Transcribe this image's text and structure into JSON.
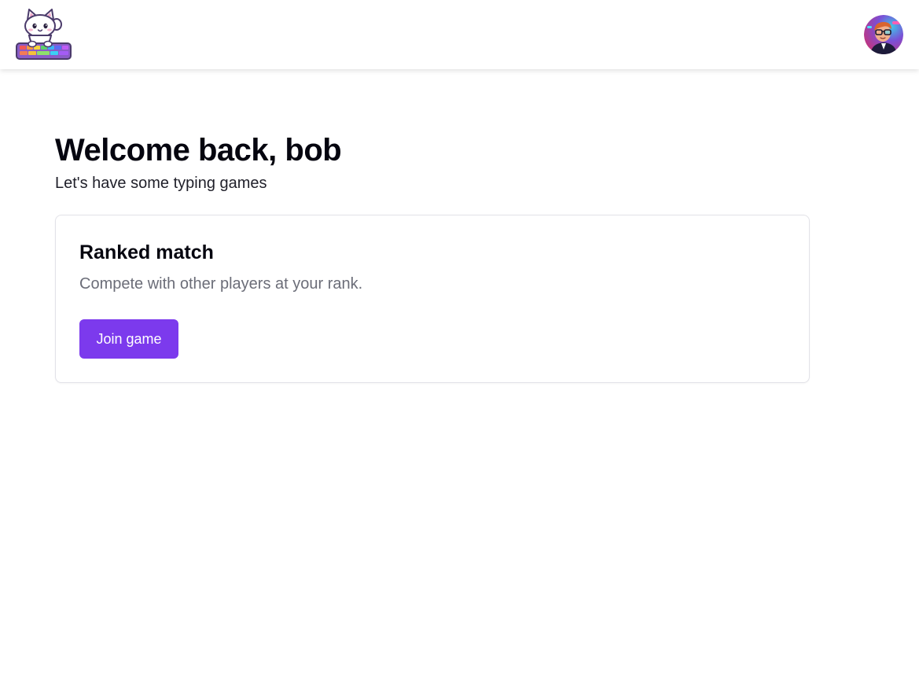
{
  "header": {
    "logo_icon": "cat-keyboard-logo",
    "avatar_icon": "user-avatar"
  },
  "main": {
    "welcome": "Welcome back, bob",
    "subtitle": "Let's have some typing games"
  },
  "ranked_card": {
    "title": "Ranked match",
    "description": "Compete with other players at your rank.",
    "button_label": "Join game"
  },
  "colors": {
    "accent": "#7c3aed",
    "muted_text": "#6b6d78",
    "card_border": "#e2e2e8"
  }
}
